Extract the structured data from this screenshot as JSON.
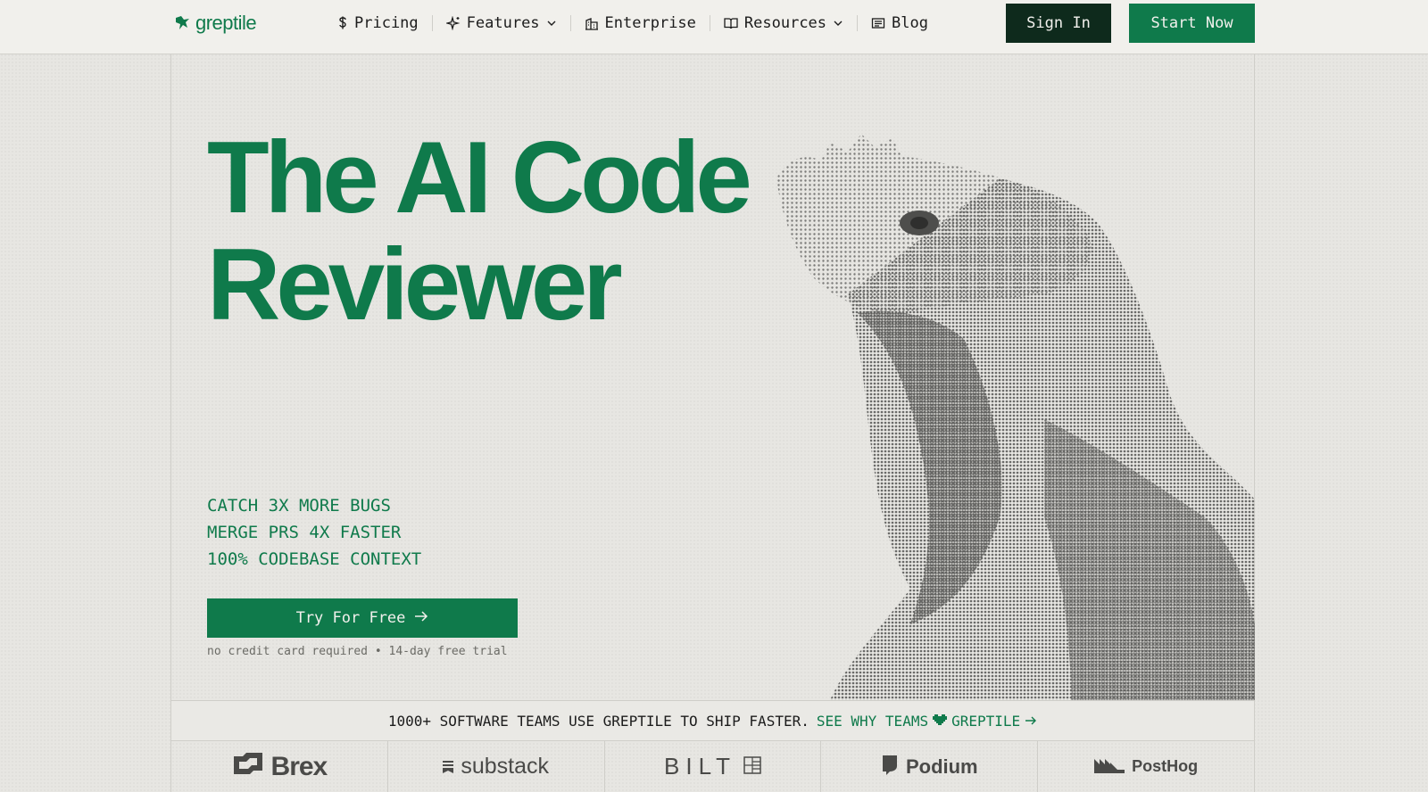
{
  "brand": {
    "name": "greptile",
    "icon": "reptile-logo-icon",
    "color": "#0f7a4b"
  },
  "nav": {
    "items": [
      {
        "label": "Pricing",
        "icon": "dollar-icon"
      },
      {
        "label": "Features",
        "icon": "sparkle-icon",
        "dropdown": true
      },
      {
        "label": "Enterprise",
        "icon": "building-icon"
      },
      {
        "label": "Resources",
        "icon": "book-icon",
        "dropdown": true
      },
      {
        "label": "Blog",
        "icon": "newspaper-icon"
      }
    ],
    "sign_in": "Sign In",
    "start_now": "Start Now"
  },
  "hero": {
    "title_line1": "The AI Code",
    "title_line2": "Reviewer",
    "taglines": [
      "CATCH 3X MORE BUGS",
      "MERGE PRS 4X FASTER",
      "100% CODEBASE CONTEXT"
    ],
    "cta": "Try For Free",
    "note": "no credit card required • 14-day free trial"
  },
  "proof": {
    "text": "1000+ SOFTWARE TEAMS USE GREPTILE TO SHIP FASTER.",
    "link_pre": "SEE WHY TEAMS",
    "link_post": "GREPTILE"
  },
  "logos": [
    {
      "name": "Brex"
    },
    {
      "name": "substack"
    },
    {
      "name": "BILT"
    },
    {
      "name": "Podium"
    },
    {
      "name": "PostHog"
    }
  ],
  "colors": {
    "accent": "#0f7a4b",
    "dark": "#0e2a1c",
    "background": "#e7e6e2"
  }
}
